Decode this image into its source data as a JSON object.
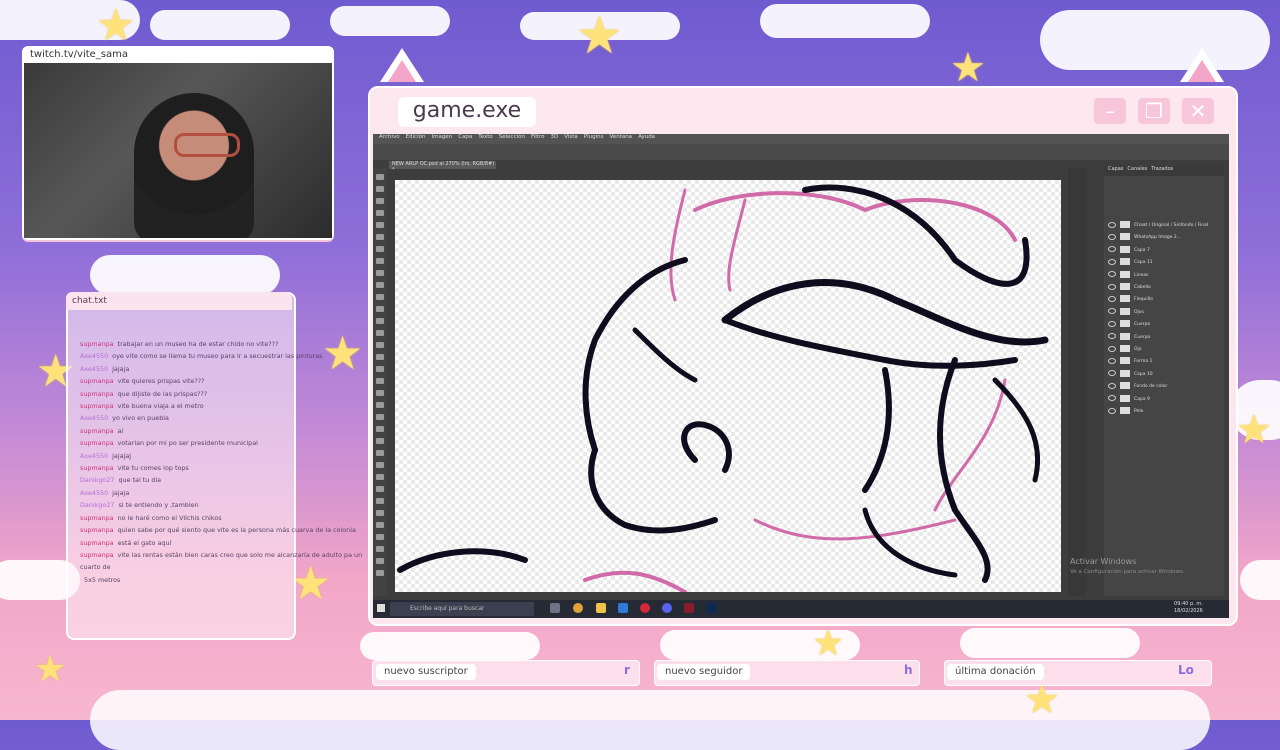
{
  "webcam": {
    "url": "twitch.tv/vite_sama"
  },
  "chat": {
    "title": "chat.txt",
    "messages": [
      {
        "user": "supmanpa",
        "text": "trabajar en un museo ha de estar chido no vite???"
      },
      {
        "user": "Axe4550",
        "text": "oye vite como se llama tu museo para ir a secuestrar las pinturas"
      },
      {
        "user": "Axe4550",
        "text": "jajaja"
      },
      {
        "user": "supmanpa",
        "text": "vite quieres prispas vite???"
      },
      {
        "user": "supmanpa",
        "text": "que dijiste de las prispas???"
      },
      {
        "user": "supmanpa",
        "text": "vite buena viaja a el metro"
      },
      {
        "user": "Axe4550",
        "text": "yo vivo en puebla"
      },
      {
        "user": "supmanpa",
        "text": "ai"
      },
      {
        "user": "supmanpa",
        "text": "votarian por mi po ser presidente municipal"
      },
      {
        "user": "Axe4550",
        "text": "jajajaj"
      },
      {
        "user": "supmanpa",
        "text": "vite tu comes lop tops"
      },
      {
        "user": "Danikgo27",
        "text": "que tal tu dia"
      },
      {
        "user": "Axe4550",
        "text": "jajaja"
      },
      {
        "user": "Danikgo27",
        "text": "si te entiendo y ,tambien"
      },
      {
        "user": "supmanpa",
        "text": "no le haré como el Vilchis chikos"
      },
      {
        "user": "supmanpa",
        "text": "quien sabe por qué siento que vite es la persona más cuarva de la colonia"
      },
      {
        "user": "supmanpa",
        "text": "está el gato aquí"
      },
      {
        "user": "supmanpa",
        "text": "vite las rentas están bien caras creo que solo me alcanzaría de adulto pa un cuarto de"
      },
      {
        "user": "",
        "text": "5x5 metros"
      }
    ]
  },
  "window": {
    "title": "game.exe",
    "min": "–",
    "max": "❐",
    "close": "✕"
  },
  "photoshop": {
    "menu": [
      "Archivo",
      "Edición",
      "Imagen",
      "Capa",
      "Texto",
      "Selección",
      "Filtro",
      "3D",
      "Vista",
      "Plugins",
      "Ventana",
      "Ayuda"
    ],
    "doc_tab": "NEW ARLP OC.psd al 270% (Irs, RGB/8#) *",
    "panel_tabs": [
      "Capas",
      "Canales",
      "Trazados"
    ],
    "layers": [
      "Chaat / Original / Sinfondo / Final",
      "WhatsApp Image 2...",
      "Capa 7",
      "Capa 11",
      "Lineas",
      "Cabello",
      "Flequillo",
      "Ojos",
      "Cuerpo",
      "Cuerpo",
      "Ojo",
      "Forma 1",
      "Capa 10",
      "Fondo de color",
      "Capa 9",
      "Pelo"
    ],
    "watermark": "Activar Windows",
    "watermark_sub": "Ve a Configuración para activar Windows."
  },
  "taskbar": {
    "search": "Escribe aquí para buscar",
    "time": "09:40 p. m.",
    "date": "18/02/2026"
  },
  "alerts": [
    {
      "label": "nuevo suscriptor",
      "value": "r"
    },
    {
      "label": "nuevo seguidor",
      "value": "h"
    },
    {
      "label": "última donación",
      "value": "Lo"
    }
  ]
}
